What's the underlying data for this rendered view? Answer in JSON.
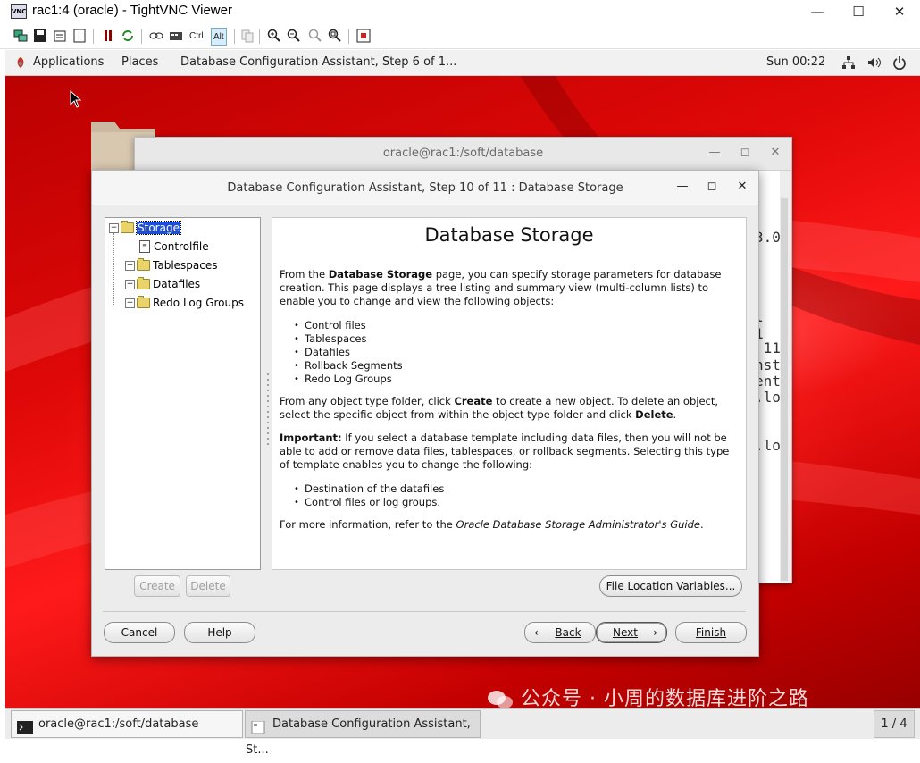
{
  "viewer": {
    "title": "rac1:4 (oracle) - TightVNC Viewer",
    "icon_text": "VNC",
    "controls": [
      "minimize-icon",
      "maximize-icon",
      "close-icon"
    ],
    "toolbar": {
      "ctrl_label": "Ctrl",
      "alt_label": "Alt"
    }
  },
  "panel": {
    "applications": "Applications",
    "places": "Places",
    "active_window": "Database Configuration Assistant, Step 6 of 1...",
    "clock": "Sun 00:22"
  },
  "terminal": {
    "title": "oracle@rac1:/soft/database",
    "fragments": [
      "3.0",
      "l 1",
      "_11",
      "nst",
      "ent",
      ".lo",
      ".lo"
    ]
  },
  "dialog": {
    "title": "Database Configuration Assistant, Step 10 of 11 : Database Storage",
    "tree": {
      "root": "Storage",
      "items": [
        "Controlfile",
        "Tablespaces",
        "Datafiles",
        "Redo Log Groups"
      ]
    },
    "help": {
      "heading": "Database Storage",
      "p1_a": "From the ",
      "p1_b": "Database Storage",
      "p1_c": " page, you can specify storage parameters for database creation. This page displays a tree listing and summary view (multi-column lists) to enable you to change and view the following objects:",
      "list1": [
        "Control files",
        "Tablespaces",
        "Datafiles",
        "Rollback Segments",
        "Redo Log Groups"
      ],
      "p2_a": "From any object type folder, click ",
      "p2_b": "Create",
      "p2_c": " to create a new object. To delete an object, select the specific object from within the object type folder and click ",
      "p2_d": "Delete",
      "p2_e": ".",
      "p3_a": "Important:",
      "p3_b": " If you select a database template including data files, then you will not be able to add or remove data files, tablespaces, or rollback segments. Selecting this type of template enables you to change the following:",
      "list2": [
        "Destination of the datafiles",
        "Control files or log groups."
      ],
      "p4_a": "For more information, refer to the ",
      "p4_b": "Oracle Database Storage Administrator's Guide",
      "p4_c": "."
    },
    "buttons": {
      "create": "Create",
      "delete": "Delete",
      "file_location": "File Location Variables...",
      "cancel": "Cancel",
      "help": "Help",
      "back": "Back",
      "next": "Next",
      "finish": "Finish"
    }
  },
  "taskbar": {
    "items": [
      "oracle@rac1:/soft/database",
      "Database Configuration Assistant, St..."
    ],
    "pager": "1 / 4"
  },
  "watermark": "公众号 · 小周的数据库进阶之路",
  "colors": {
    "desktop": "#d40000",
    "selection": "#1c4fd6"
  }
}
